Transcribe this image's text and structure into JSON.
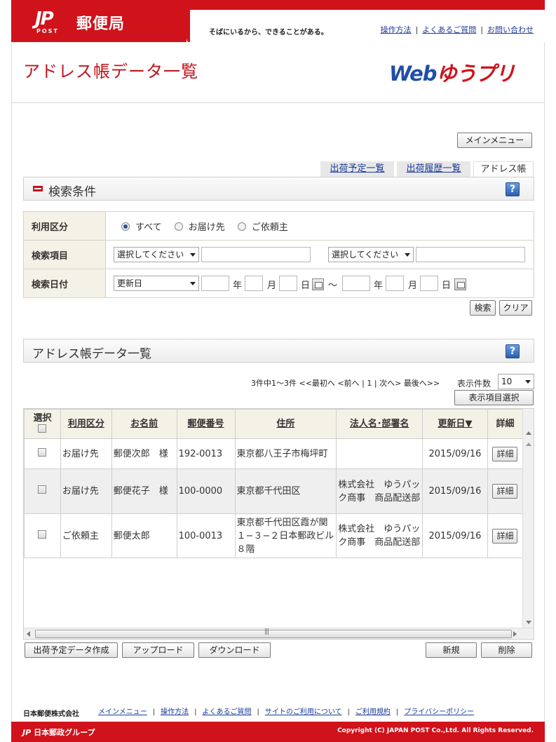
{
  "header": {
    "logo_mark": "JP",
    "logo_post": "POST",
    "logo_name": "郵便局",
    "tagline": "そばにいるから、できることがある。",
    "links": [
      "操作方法",
      "よくあるご質問",
      "お問い合わせ"
    ],
    "separator": "|"
  },
  "page": {
    "title": "アドレス帳データ一覧",
    "service_logo_web": "Web",
    "service_logo_name": "ゆうプリ"
  },
  "main_menu_label": "メインメニュー",
  "tabs": [
    {
      "label": "出荷予定一覧",
      "active": false
    },
    {
      "label": "出荷履歴一覧",
      "active": false
    },
    {
      "label": "アドレス帳",
      "active": true
    }
  ],
  "search": {
    "section_title": "検索条件",
    "help": "?",
    "usage_label": "利用区分",
    "usage_options": [
      "すべて",
      "お届け先",
      "ご依頼主"
    ],
    "usage_selected": "すべて",
    "item_label": "検索項目",
    "item_select1": "選択してください",
    "item_select2": "選択してください",
    "item_value1": "",
    "item_value2": "",
    "date_label": "検索日付",
    "date_select": "更新日",
    "year": "年",
    "month": "月",
    "day": "日",
    "tilde": "〜",
    "search_button": "検索",
    "clear_button": "クリア"
  },
  "list": {
    "section_title": "アドレス帳データ一覧",
    "help": "?",
    "pager": {
      "summary": "3件中1〜3件",
      "first": "<<最初へ",
      "prev": "<前へ",
      "page": "1",
      "next": "次へ>",
      "last": "最後へ>>",
      "sep": "|"
    },
    "count_label": "表示件数",
    "count_value": "10",
    "column_select_button": "表示項目選択",
    "columns": [
      "選択",
      "利用区分",
      "お名前",
      "郵便番号",
      "住所",
      "法人名･部署名",
      "更新日▼",
      "詳細"
    ],
    "rows": [
      {
        "usage": "お届け先",
        "name": "郵便次郎　様",
        "zip": "192-0013",
        "address": "東京都八王子市梅坪町",
        "company": "",
        "updated": "2015/09/16",
        "detail": "詳細"
      },
      {
        "usage": "お届け先",
        "name": "郵便花子　様",
        "zip": "100-0000",
        "address": "東京都千代田区",
        "company": "株式会社　ゆうパック商事　商品配送部",
        "updated": "2015/09/16",
        "detail": "詳細"
      },
      {
        "usage": "ご依頼主",
        "name": "郵便太郎",
        "zip": "100-0013",
        "address": "東京都千代田区霞が関１−３−２日本郵政ビル８階",
        "company": "株式会社　ゆうパック商事　商品配送部",
        "updated": "2015/09/16",
        "detail": "詳細"
      }
    ]
  },
  "actions": {
    "create": "出荷予定データ作成",
    "upload": "アップロード",
    "download": "ダウンロード",
    "new": "新規",
    "delete": "削除"
  },
  "footer": {
    "company": "日本郵便株式会社",
    "links": [
      "メインメニュー",
      "操作方法",
      "よくあるご質問",
      "サイトのご利用について",
      "ご利用規約",
      "プライバシーポリシー"
    ],
    "group_mark": "JP",
    "group_name": "日本郵政グループ",
    "copyright": "Copyright (C) JAPAN POST Co.,Ltd.  All Rights Reserved."
  },
  "colors": {
    "brand_red": "#d0121b",
    "link_blue": "#1a3a9a",
    "logo_blue": "#1f4fa8"
  }
}
